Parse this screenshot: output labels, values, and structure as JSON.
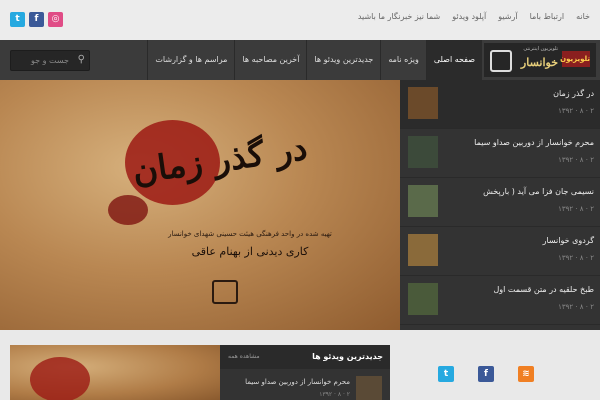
{
  "top": {
    "links": [
      "خانه",
      "ارتباط باما",
      "آرشیو",
      "آپلود ویدئو",
      "شما نیز خبرنگار ما باشید"
    ]
  },
  "social": {
    "top": [
      "twitter",
      "facebook",
      "dribbble"
    ],
    "bottom": [
      "twitter",
      "facebook",
      "rss"
    ],
    "colors": {
      "twitter": "#26a9e0",
      "facebook": "#3b5998",
      "dribbble": "#e04c86",
      "rss": "#f07f23"
    }
  },
  "logo": {
    "name": "خوانسار",
    "badge": "تلويزيون",
    "tagline": "تلویزیون اینترنتی"
  },
  "nav": {
    "items": [
      {
        "label": "صفحه اصلی",
        "active": true
      },
      {
        "label": "ویژه نامه"
      },
      {
        "label": "جدیدترین ویدئو ها"
      },
      {
        "label": "آخرین مصاحبه ها"
      },
      {
        "label": "مراسم ها و گزارشات"
      }
    ]
  },
  "search": {
    "placeholder": "جست و جو"
  },
  "hero": {
    "script": "در گذر زمان",
    "subtitle": "تهیه شده در واحد فرهنگی هیئت حسینی شهدای خوانسار",
    "credit": "کاری دیدنی از بهنام عاقی"
  },
  "video_list": [
    {
      "title": "در گذر زمان",
      "meta": "۱۳۹۲ · ۸ · ۲",
      "active": true
    },
    {
      "title": "محرم خوانسار از دوربین صداو سیما",
      "meta": "۱۳۹۲ · ۸ · ۲"
    },
    {
      "title": "نسیمی جان فزا می آید ( بارپخش",
      "meta": "۱۳۹۲ · ۸ · ۲"
    },
    {
      "title": "گردوی خوانسار",
      "meta": "۱۳۹۲ · ۸ · ۲"
    },
    {
      "title": "طبخ حلقیه در متن قسمت اول",
      "meta": "۱۳۹۲ · ۸ · ۲"
    }
  ],
  "new_videos": {
    "heading": "جدیدترین ویدئو ها",
    "view_all": "مشاهده همه",
    "first_title": "محرم خوانسار از دوربین صداو سیما",
    "first_meta": "۱۳۹۲ · ۸ · ۲"
  }
}
